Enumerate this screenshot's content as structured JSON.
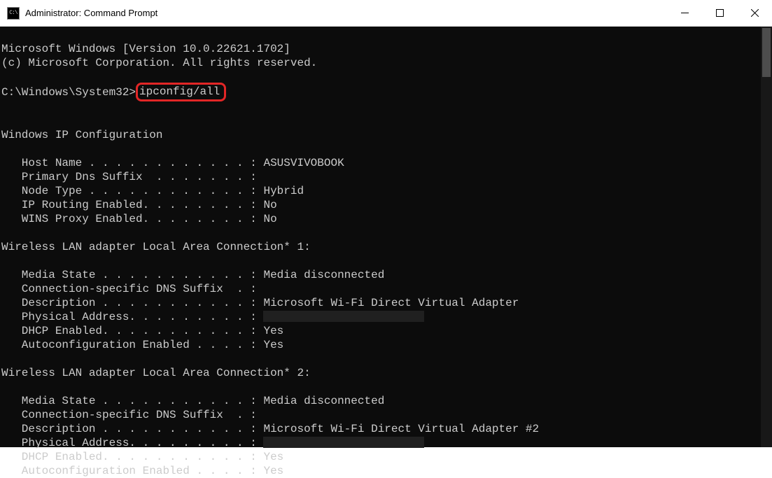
{
  "window": {
    "title": "Administrator: Command Prompt"
  },
  "prompt": {
    "path": "C:\\Windows\\System32>",
    "cmd": "ipconfig/all"
  },
  "out": {
    "l1": "Microsoft Windows [Version 10.0.22621.1702]",
    "l2": "(c) Microsoft Corporation. All rights reserved.",
    "hdr": "Windows IP Configuration",
    "host": "   Host Name . . . . . . . . . . . . : ASUSVIVOBOOK",
    "dns": "   Primary Dns Suffix  . . . . . . . :",
    "node": "   Node Type . . . . . . . . . . . . : Hybrid",
    "iprt": "   IP Routing Enabled. . . . . . . . : No",
    "wins": "   WINS Proxy Enabled. . . . . . . . : No",
    "a1_hdr": "Wireless LAN adapter Local Area Connection* 1:",
    "a1_media": "   Media State . . . . . . . . . . . : Media disconnected",
    "a1_csdns": "   Connection-specific DNS Suffix  . :",
    "a1_desc": "   Description . . . . . . . . . . . : Microsoft Wi-Fi Direct Virtual Adapter",
    "a1_phys": "   Physical Address. . . . . . . . . : ",
    "a1_dhcp": "   DHCP Enabled. . . . . . . . . . . : Yes",
    "a1_auto": "   Autoconfiguration Enabled . . . . : Yes",
    "a2_hdr": "Wireless LAN adapter Local Area Connection* 2:",
    "a2_media": "   Media State . . . . . . . . . . . : Media disconnected",
    "a2_csdns": "   Connection-specific DNS Suffix  . :",
    "a2_desc": "   Description . . . . . . . . . . . : Microsoft Wi-Fi Direct Virtual Adapter #2",
    "a2_phys": "   Physical Address. . . . . . . . . : ",
    "a2_dhcp": "   DHCP Enabled. . . . . . . . . . . : Yes",
    "a2_auto": "   Autoconfiguration Enabled . . . . : Yes"
  }
}
